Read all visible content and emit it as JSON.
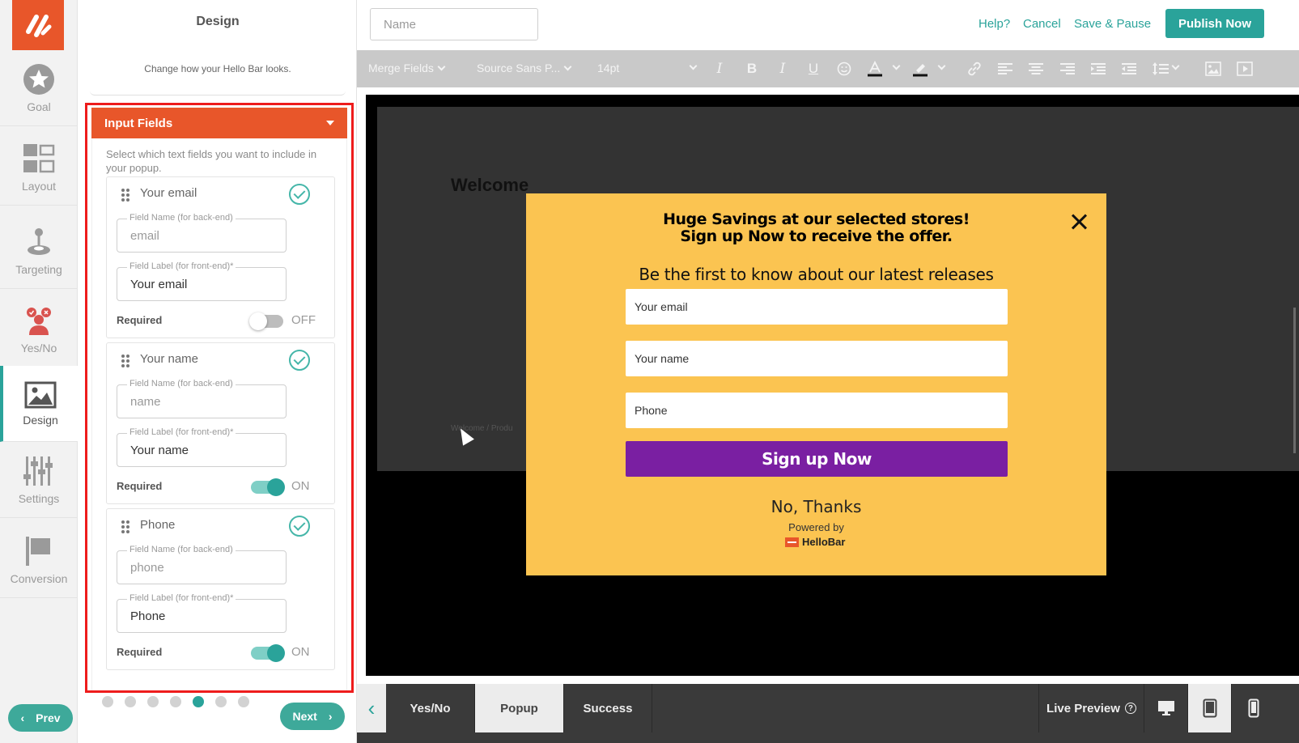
{
  "nav": {
    "items": [
      {
        "label": "Goal",
        "icon": "star-icon"
      },
      {
        "label": "Layout",
        "icon": "layout-grid-icon"
      },
      {
        "label": "Targeting",
        "icon": "joystick-icon"
      },
      {
        "label": "Yes/No",
        "icon": "users-icon"
      },
      {
        "label": "Design",
        "icon": "image-icon",
        "active": true
      },
      {
        "label": "Settings",
        "icon": "sliders-icon"
      },
      {
        "label": "Conversion",
        "icon": "flag-icon"
      }
    ]
  },
  "panel": {
    "title": "Design",
    "subtitle": "Change how your Hello Bar looks.",
    "section_title": "Input Fields",
    "section_desc": "Select which text fields you want to include in your popup.",
    "fields": [
      {
        "title": "Your email",
        "name_caption": "Field Name (for back-end)",
        "name_value": "email",
        "label_caption": "Field Label (for front-end)*",
        "label_value": "Your email",
        "required_label": "Required",
        "required_state": "OFF"
      },
      {
        "title": "Your name",
        "name_caption": "Field Name (for back-end)",
        "name_value": "name",
        "label_caption": "Field Label (for front-end)*",
        "label_value": "Your name",
        "required_label": "Required",
        "required_state": "ON"
      },
      {
        "title": "Phone",
        "name_caption": "Field Name (for back-end)",
        "name_value": "phone",
        "label_caption": "Field Label (for front-end)*",
        "label_value": "Phone",
        "required_label": "Required",
        "required_state": "ON"
      }
    ],
    "prev_label": "Prev",
    "next_label": "Next",
    "step_current": 5,
    "step_total": 7
  },
  "topbar": {
    "name_placeholder": "Name",
    "help": "Help?",
    "cancel": "Cancel",
    "save_pause": "Save & Pause",
    "publish": "Publish Now"
  },
  "toolbar": {
    "merge_fields": "Merge Fields",
    "font": "Source Sans P...",
    "size": "14pt"
  },
  "canvas": {
    "welcome": "Welcome",
    "breadcrumb": "Welcome / Produ"
  },
  "popup": {
    "headline_1": "Huge Savings at our selected stores!",
    "headline_2": "Sign up Now to receive the offer.",
    "subhead": "Be the first to know about our latest releases",
    "field_email": "Your email",
    "field_name": "Your name",
    "field_phone": "Phone",
    "cta": "Sign up Now",
    "no_thanks": "No, Thanks",
    "powered_by": "Powered by",
    "brand": "HelloBar"
  },
  "bottombar": {
    "tabs": [
      "Yes/No",
      "Popup",
      "Success"
    ],
    "active_tab": "Popup",
    "live_preview": "Live Preview",
    "help_glyph": "?"
  },
  "colors": {
    "brand_orange": "#e8562a",
    "teal": "#2aa39a",
    "popup_bg": "#fbc451",
    "cta_purple": "#7a1fa2",
    "highlight_red": "#ee1c1c"
  }
}
